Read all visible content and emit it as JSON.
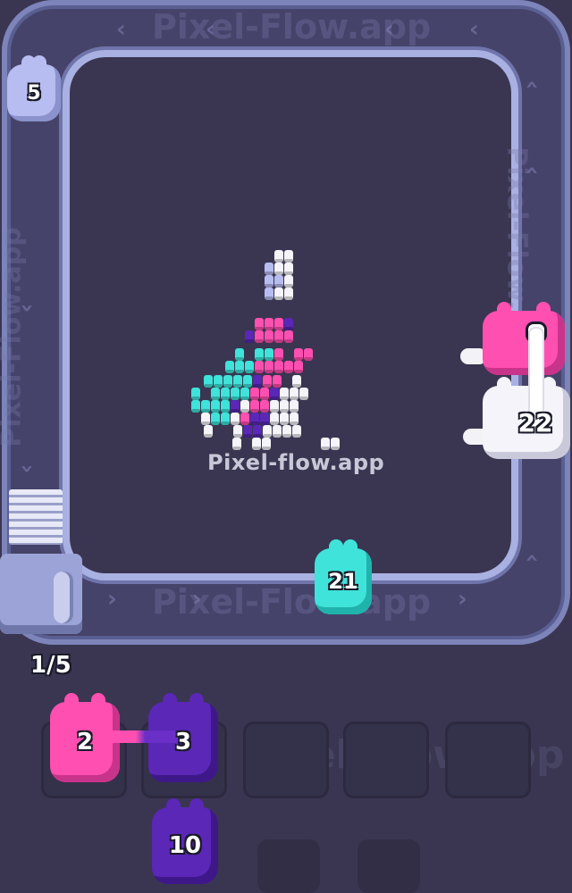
{
  "game": {
    "watermark_text": "Pixel-Flow.app",
    "site_label": "Pixel-flow.app",
    "counter": "1/5"
  },
  "colors": {
    "background": "#3a3651",
    "track": "#46436a",
    "track_rail": "#a9b1e2",
    "pink": "#ff4fb0",
    "purple": "#5a27b6",
    "cyan": "#3fe3d9",
    "white": "#f4f4fa",
    "lavender": "#b7bdf0"
  },
  "blobs": [
    {
      "id": "lavender-blob",
      "number": "5",
      "color": "lavender",
      "location": "conveyor-top-left"
    },
    {
      "id": "pink-blob-conveyor",
      "number": "",
      "color": "pink",
      "location": "conveyor-right"
    },
    {
      "id": "white-blob-conveyor",
      "number": "22",
      "color": "white",
      "location": "conveyor-right"
    },
    {
      "id": "cyan-blob-conveyor",
      "number": "21",
      "color": "cyan",
      "location": "conveyor-bottom"
    },
    {
      "id": "pink-blob-slot",
      "number": "2",
      "color": "pink",
      "location": "slot-1"
    },
    {
      "id": "purple-blob-slot",
      "number": "3",
      "color": "purple",
      "location": "slot-2"
    },
    {
      "id": "purple-blob-queue",
      "number": "10",
      "color": "purple",
      "location": "queue"
    }
  ],
  "slots": {
    "count": 5,
    "filled": 2
  }
}
